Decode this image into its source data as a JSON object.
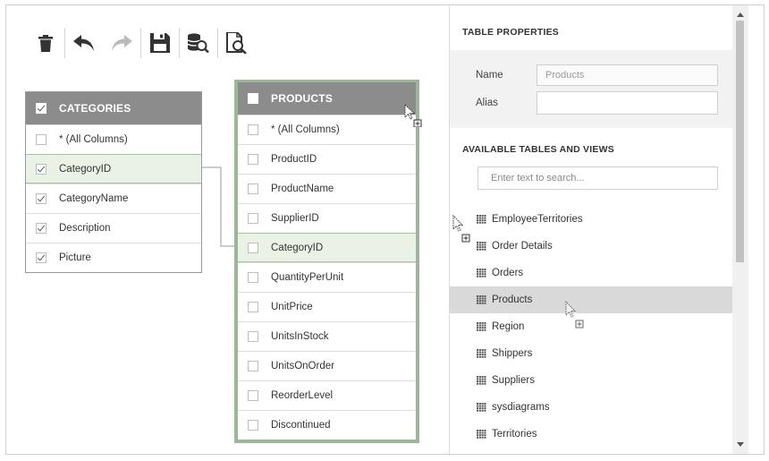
{
  "toolbar": {
    "buttons": [
      {
        "name": "delete",
        "icon": "trash-icon",
        "enabled": true
      },
      {
        "name": "undo",
        "icon": "undo-icon",
        "enabled": true
      },
      {
        "name": "redo",
        "icon": "redo-icon",
        "enabled": false
      },
      {
        "name": "save",
        "icon": "save-icon",
        "enabled": true
      },
      {
        "name": "data-preview",
        "icon": "database-search-icon",
        "enabled": true
      },
      {
        "name": "sql-preview",
        "icon": "document-search-icon",
        "enabled": true
      }
    ]
  },
  "categories_table": {
    "title": "CATEGORIES",
    "title_checked": true,
    "rows": [
      {
        "label": "* (All Columns)",
        "checked": false,
        "selected": false
      },
      {
        "label": "CategoryID",
        "checked": true,
        "selected": true
      },
      {
        "label": "CategoryName",
        "checked": true,
        "selected": false
      },
      {
        "label": "Description",
        "checked": true,
        "selected": false
      },
      {
        "label": "Picture",
        "checked": true,
        "selected": false
      }
    ]
  },
  "products_table": {
    "title": "PRODUCTS",
    "title_checked": false,
    "rows": [
      {
        "label": "* (All Columns)",
        "checked": false,
        "selected": false
      },
      {
        "label": "ProductID",
        "checked": false,
        "selected": false
      },
      {
        "label": "ProductName",
        "checked": false,
        "selected": false
      },
      {
        "label": "SupplierID",
        "checked": false,
        "selected": false
      },
      {
        "label": "CategoryID",
        "checked": false,
        "selected": true
      },
      {
        "label": "QuantityPerUnit",
        "checked": false,
        "selected": false
      },
      {
        "label": "UnitPrice",
        "checked": false,
        "selected": false
      },
      {
        "label": "UnitsInStock",
        "checked": false,
        "selected": false
      },
      {
        "label": "UnitsOnOrder",
        "checked": false,
        "selected": false
      },
      {
        "label": "ReorderLevel",
        "checked": false,
        "selected": false
      },
      {
        "label": "Discontinued",
        "checked": false,
        "selected": false
      }
    ]
  },
  "right_panel": {
    "table_properties_title": "TABLE PROPERTIES",
    "name_label": "Name",
    "name_value": "Products",
    "alias_label": "Alias",
    "alias_value": "",
    "available_title": "AVAILABLE TABLES AND VIEWS",
    "search_placeholder": "Enter text to search...",
    "items": [
      {
        "label": "EmployeeTerritories",
        "selected": false
      },
      {
        "label": "Order Details",
        "selected": false
      },
      {
        "label": "Orders",
        "selected": false
      },
      {
        "label": "Products",
        "selected": true
      },
      {
        "label": "Region",
        "selected": false
      },
      {
        "label": "Shippers",
        "selected": false
      },
      {
        "label": "Suppliers",
        "selected": false
      },
      {
        "label": "sysdiagrams",
        "selected": false
      },
      {
        "label": "Territories",
        "selected": false
      }
    ]
  },
  "colors": {
    "header_gray": "#8c8c8c",
    "selected_row_green": "#e9f2e4",
    "products_border_green": "#9bb896",
    "list_selected_gray": "#d9d9d9"
  }
}
